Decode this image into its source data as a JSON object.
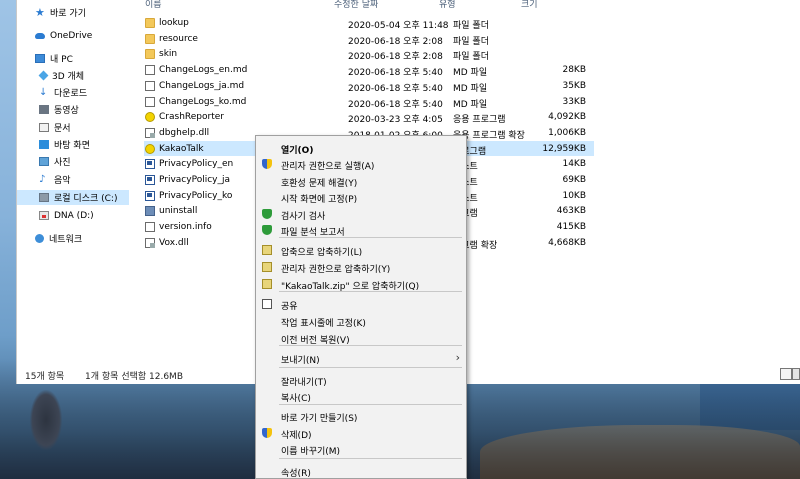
{
  "nav": [
    {
      "label": "바로 가기",
      "icon": "star-icon"
    },
    {
      "label": "OneDrive",
      "icon": "cloud-icon"
    },
    {
      "label": "내 PC",
      "icon": "pc-icon"
    },
    {
      "label": "3D 개체",
      "icon": "cube-icon"
    },
    {
      "label": "다운로드",
      "icon": "download-icon"
    },
    {
      "label": "동영상",
      "icon": "video-icon"
    },
    {
      "label": "문서",
      "icon": "document-icon"
    },
    {
      "label": "바탕 화면",
      "icon": "desktop-icon"
    },
    {
      "label": "사진",
      "icon": "picture-icon"
    },
    {
      "label": "음악",
      "icon": "music-icon"
    },
    {
      "label": "로컬 디스크 (C:)",
      "icon": "disk-icon"
    },
    {
      "label": "DNA (D:)",
      "icon": "usb-drive-icon"
    },
    {
      "label": "네트워크",
      "icon": "network-icon"
    }
  ],
  "columns": {
    "name": "이름",
    "date": "수정한 날짜",
    "type": "유형",
    "size": "크기"
  },
  "files": [
    {
      "name": "lookup",
      "date": "2020-05-04 오후 11:48",
      "type": "파일 폴더",
      "size": "",
      "icon": "folder-icon"
    },
    {
      "name": "resource",
      "date": "2020-06-18 오후 2:08",
      "type": "파일 폴더",
      "size": "",
      "icon": "folder-icon"
    },
    {
      "name": "skin",
      "date": "2020-06-18 오후 2:08",
      "type": "파일 폴더",
      "size": "",
      "icon": "folder-icon"
    },
    {
      "name": "ChangeLogs_en.md",
      "date": "2020-06-18 오후 5:40",
      "type": "MD 파일",
      "size": "28KB",
      "icon": "md-file-icon"
    },
    {
      "name": "ChangeLogs_ja.md",
      "date": "2020-06-18 오후 5:40",
      "type": "MD 파일",
      "size": "35KB",
      "icon": "md-file-icon"
    },
    {
      "name": "ChangeLogs_ko.md",
      "date": "2020-06-18 오후 5:40",
      "type": "MD 파일",
      "size": "33KB",
      "icon": "md-file-icon"
    },
    {
      "name": "CrashReporter",
      "date": "2020-03-23 오후 4:05",
      "type": "응용 프로그램",
      "size": "4,092KB",
      "icon": "kakao-app-icon"
    },
    {
      "name": "dbghelp.dll",
      "date": "2018-01-02 오후 6:00",
      "type": "응용 프로그램 확장",
      "size": "1,006KB",
      "icon": "dll-file-icon"
    },
    {
      "name": "KakaoTalk",
      "date": "",
      "type": "프로그램",
      "size": "12,959KB",
      "icon": "kakao-app-icon"
    },
    {
      "name": "PrivacyPolicy_en",
      "date": "",
      "type": "텍스트",
      "size": "14KB",
      "icon": "rtf-file-icon"
    },
    {
      "name": "PrivacyPolicy_ja",
      "date": "",
      "type": "텍스트",
      "size": "69KB",
      "icon": "rtf-file-icon"
    },
    {
      "name": "PrivacyPolicy_ko",
      "date": "",
      "type": "텍스트",
      "size": "10KB",
      "icon": "rtf-file-icon"
    },
    {
      "name": "uninstall",
      "date": "",
      "type": "로그램",
      "size": "463KB",
      "icon": "uninstall-icon"
    },
    {
      "name": "version.info",
      "date": "",
      "type": "",
      "size": "415KB",
      "icon": "info-file-icon"
    },
    {
      "name": "Vox.dll",
      "date": "",
      "type": "로그램 확장",
      "size": "4,668KB",
      "icon": "dll-file-icon"
    }
  ],
  "status": {
    "count": "15개 항목",
    "selection": "1개 항목 선택함 12.6MB"
  },
  "context_menu": [
    {
      "label": "열기(O)",
      "bold": true,
      "icon": ""
    },
    {
      "label": "관리자 권한으로 실행(A)",
      "icon": "shield-icon"
    },
    {
      "label": "호환성 문제 해결(Y)",
      "icon": ""
    },
    {
      "label": "시작 화면에 고정(P)",
      "icon": ""
    },
    {
      "label": "검사기 검사",
      "icon": "defender-icon"
    },
    {
      "label": "파일 분석 보고서",
      "icon": "defender-icon"
    },
    {
      "label": "압축으로 압축하기(L)",
      "icon": "zip-icon"
    },
    {
      "label": "관리자 권한으로 압축하기(Y)",
      "icon": "zip-icon"
    },
    {
      "label": "\"KakaoTalk.zip\" 으로 압축하기(Q)",
      "icon": "zip-icon"
    },
    {
      "label": "공유",
      "icon": "share-icon"
    },
    {
      "label": "작업 표시줄에 고정(K)",
      "icon": ""
    },
    {
      "label": "이전 버전 복원(V)",
      "icon": ""
    },
    {
      "label": "보내기(N)",
      "icon": "",
      "submenu": true
    },
    {
      "label": "잘라내기(T)",
      "icon": ""
    },
    {
      "label": "복사(C)",
      "icon": ""
    },
    {
      "label": "바로 가기 만들기(S)",
      "icon": ""
    },
    {
      "label": "삭제(D)",
      "icon": "shield-icon"
    },
    {
      "label": "이름 바꾸기(M)",
      "icon": ""
    },
    {
      "label": "속성(R)",
      "icon": ""
    }
  ]
}
